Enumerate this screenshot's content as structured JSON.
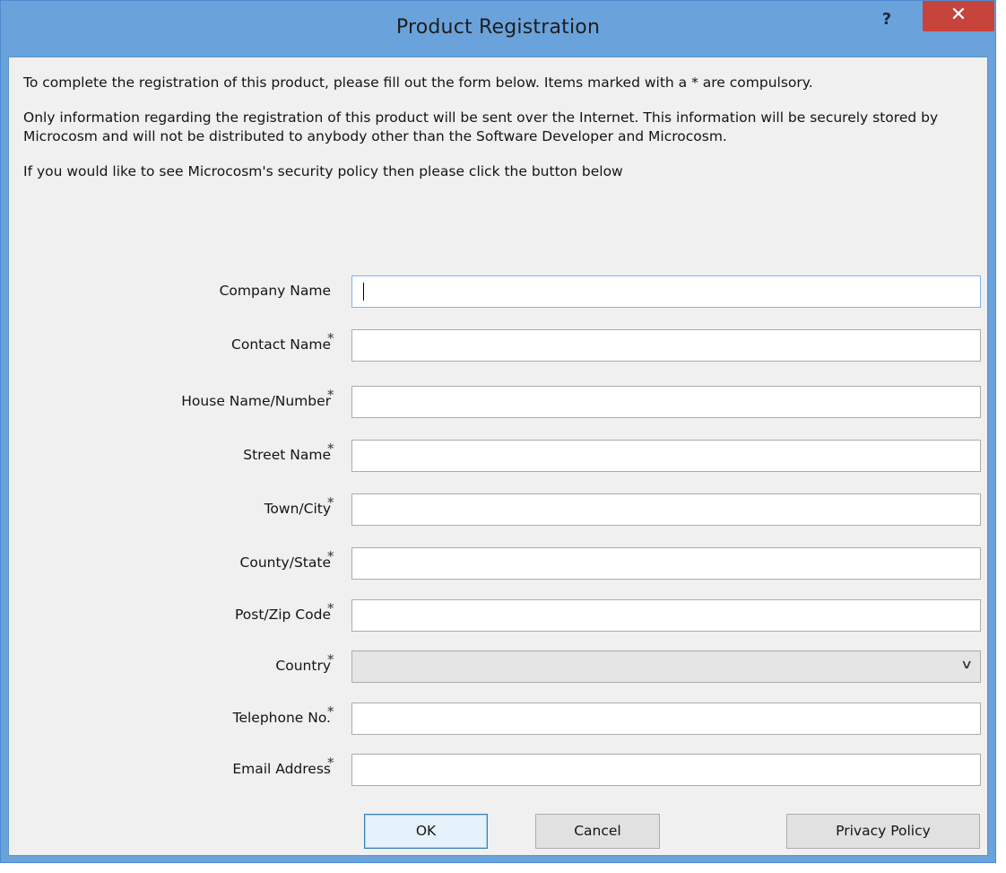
{
  "window": {
    "title": "Product Registration",
    "help_label": "?",
    "close_label": "✕"
  },
  "intro": {
    "line1": "To complete the registration of this product, please fill out the form below. Items marked with a * are compulsory.",
    "line2": "Only information regarding the registration of this product will be sent over the Internet. This information will be securely stored by Microcosm and will not be distributed to anybody other than the Software Developer and Microcosm.",
    "line3": "If you would like to see Microcosm's security policy then please click the button below"
  },
  "form": {
    "required_marker": "*",
    "company_name": {
      "label": "Company Name",
      "value": ""
    },
    "contact_name": {
      "label": "Contact Name",
      "value": ""
    },
    "house": {
      "label": "House Name/Number",
      "value": ""
    },
    "street": {
      "label": "Street Name",
      "value": ""
    },
    "town": {
      "label": "Town/City",
      "value": ""
    },
    "county": {
      "label": "County/State",
      "value": ""
    },
    "postcode": {
      "label": "Post/Zip Code",
      "value": ""
    },
    "country": {
      "label": "Country",
      "selected": ""
    },
    "telephone": {
      "label": "Telephone No.",
      "value": ""
    },
    "email": {
      "label": "Email Address",
      "value": ""
    }
  },
  "buttons": {
    "ok": "OK",
    "cancel": "Cancel",
    "privacy": "Privacy Policy"
  },
  "icons": {
    "dropdown": "chevron-down-icon",
    "help": "help-icon",
    "close": "close-icon"
  },
  "colors": {
    "close_button": "#c7443c",
    "window_frame": "#6aa3dc",
    "focus_border": "#7eb4ea"
  }
}
